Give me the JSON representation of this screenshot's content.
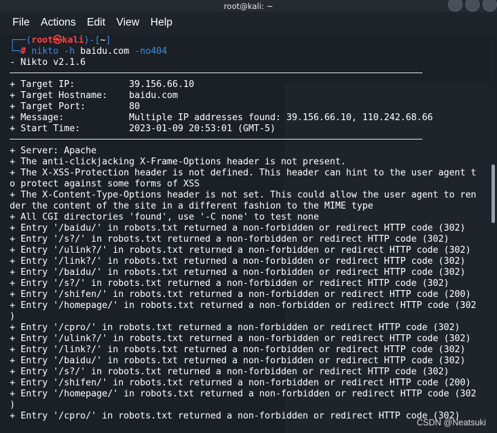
{
  "window": {
    "title": "root@kali: ~"
  },
  "menu": [
    "File",
    "Actions",
    "Edit",
    "View",
    "Help"
  ],
  "prompt": {
    "line1_prefix": "┌──(",
    "user": "root",
    "at": "㉿",
    "host": "kali",
    "line1_mid": ")-[",
    "dir": "~",
    "line1_suffix": "]",
    "line2_prefix": "└─",
    "hash": "# ",
    "cmd": "nikto",
    "cmd_h": " -h",
    "cmd_target": " baidu.com",
    "cmd_flag": " -no404"
  },
  "output": {
    "version": "- Nikto v2.1.6",
    "info": [
      "+ Target IP:          39.156.66.10",
      "+ Target Hostname:    baidu.com",
      "+ Target Port:        80",
      "+ Message:            Multiple IP addresses found: 39.156.66.10, 110.242.68.66",
      "+ Start Time:         2023-01-09 20:53:01 (GMT-5)"
    ],
    "results": [
      "+ Server: Apache",
      "+ The anti-clickjacking X-Frame-Options header is not present.",
      "+ The X-XSS-Protection header is not defined. This header can hint to the user agent t",
      "o protect against some forms of XSS",
      "+ The X-Content-Type-Options header is not set. This could allow the user agent to ren",
      "der the content of the site in a different fashion to the MIME type",
      "+ All CGI directories 'found', use '-C none' to test none",
      "+ Entry '/baidu/' in robots.txt returned a non-forbidden or redirect HTTP code (302)",
      "+ Entry '/s?/' in robots.txt returned a non-forbidden or redirect HTTP code (302)",
      "+ Entry '/ulink?/' in robots.txt returned a non-forbidden or redirect HTTP code (302)",
      "+ Entry '/link?/' in robots.txt returned a non-forbidden or redirect HTTP code (302)",
      "+ Entry '/baidu/' in robots.txt returned a non-forbidden or redirect HTTP code (302)",
      "+ Entry '/s?/' in robots.txt returned a non-forbidden or redirect HTTP code (302)",
      "+ Entry '/shifen/' in robots.txt returned a non-forbidden or redirect HTTP code (200)",
      "+ Entry '/homepage/' in robots.txt returned a non-forbidden or redirect HTTP code (302",
      ")",
      "+ Entry '/cpro/' in robots.txt returned a non-forbidden or redirect HTTP code (302)",
      "+ Entry '/ulink?/' in robots.txt returned a non-forbidden or redirect HTTP code (302)",
      "+ Entry '/link?/' in robots.txt returned a non-forbidden or redirect HTTP code (302)",
      "+ Entry '/baidu/' in robots.txt returned a non-forbidden or redirect HTTP code (302)",
      "+ Entry '/s?/' in robots.txt returned a non-forbidden or redirect HTTP code (302)",
      "+ Entry '/shifen/' in robots.txt returned a non-forbidden or redirect HTTP code (200)",
      "+ Entry '/homepage/' in robots.txt returned a non-forbidden or redirect HTTP code (302",
      ")",
      "+ Entry '/cpro/' in robots.txt returned a non-forbidden or redirect HTTP code (302)"
    ]
  },
  "watermark": "CSDN @Neatsuki"
}
